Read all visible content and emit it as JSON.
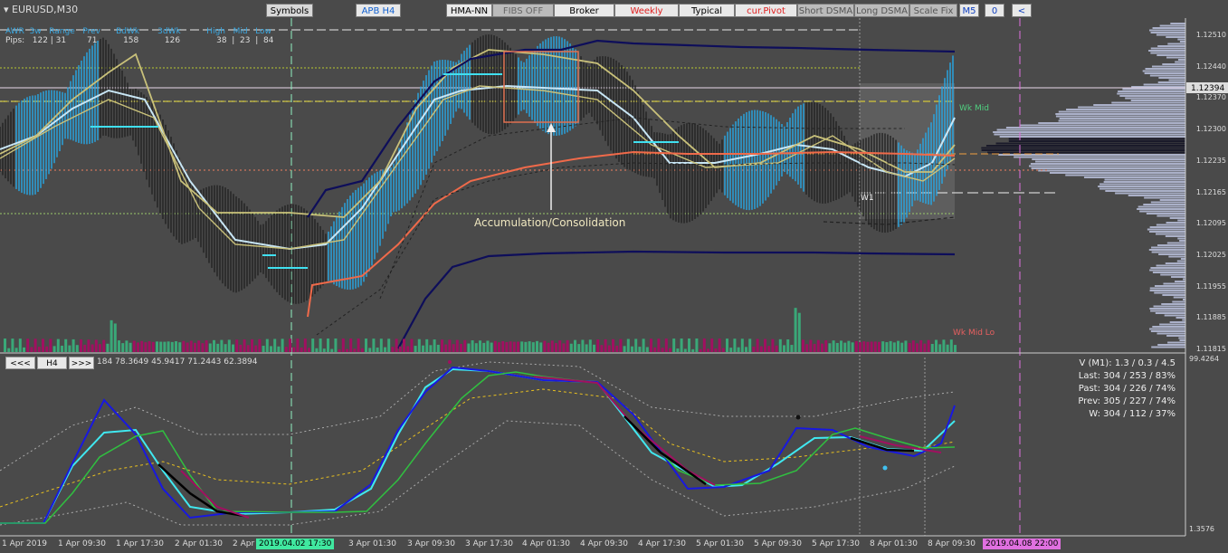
{
  "symbol": "EURUSD,M30",
  "toolbar": {
    "symbols": "Symbols",
    "apb": "APB H4",
    "hma": "HMA-NN",
    "fibs": "FIBS OFF",
    "broker": "Broker",
    "weekly": "Weekly",
    "typical": "Typical",
    "curpivot": "cur.Pivot",
    "short_dsma": "Short DSMA",
    "long_dsma": "Long DSMA",
    "scale_fix": "Scale Fix",
    "m5": "M5",
    "zero": "0",
    "back": "<"
  },
  "stats": {
    "line1": "AWR  3w   Range   Prev      BdWk       3dWk          High   Mid   Low",
    "line2": "Pips:   122 | 31        71          158          126              38  |  23  |  84"
  },
  "annotation": "Accumulation/Consolidation",
  "labels": {
    "wk_mid": "Wk Mid",
    "wk_mid_lo": "Wk Mid Lo",
    "w1": "W1"
  },
  "price_axis": [
    "1.12510",
    "1.12440",
    "1.12370",
    "1.12300",
    "1.12235",
    "1.12165",
    "1.12095",
    "1.12025",
    "1.11955",
    "1.11885",
    "1.11815"
  ],
  "current_price": "1.12394",
  "sub_axis": {
    "top": "99.4264",
    "bottom": "1.3576"
  },
  "sub_nav": {
    "prev": "<<<",
    "tf": "H4",
    "next": ">>>"
  },
  "sub_values": "184 78.3649 45.9417 71.2443 62.3894",
  "sub_stats": [
    "V (M1): 1.3 / 0.3 / 4.5",
    "Last: 304 / 253 / 83%",
    "Past: 304 / 226 / 74%",
    "Prev: 305 / 227 / 74%",
    "W: 304 / 112 / 37%"
  ],
  "time_axis": [
    "1 Apr 2019",
    "1 Apr 09:30",
    "1 Apr 17:30",
    "2 Apr 01:30",
    "2 Apr",
    "3 Apr 01:30",
    "3 Apr 09:30",
    "3 Apr 17:30",
    "4 Apr 01:30",
    "4 Apr 09:30",
    "4 Apr 17:30",
    "5 Apr 01:30",
    "5 Apr 09:30",
    "5 Apr 17:30",
    "8 Apr 01:30",
    "8 Apr 09:30"
  ],
  "time_marker_left": "2019.04.02 17:30",
  "time_marker_right": "2019.04.08 22:00",
  "colors": {
    "bg": "#4a4a4a",
    "blue_bars": "#27a9e8",
    "black_bars": "#222222",
    "navy": "#0e0e5a",
    "khaki": "#c9c17a",
    "lightblue": "#c8e6f5",
    "salmon": "#f06a4a",
    "magenta_marker": "#e070e0",
    "green_marker": "#38e09a"
  }
}
